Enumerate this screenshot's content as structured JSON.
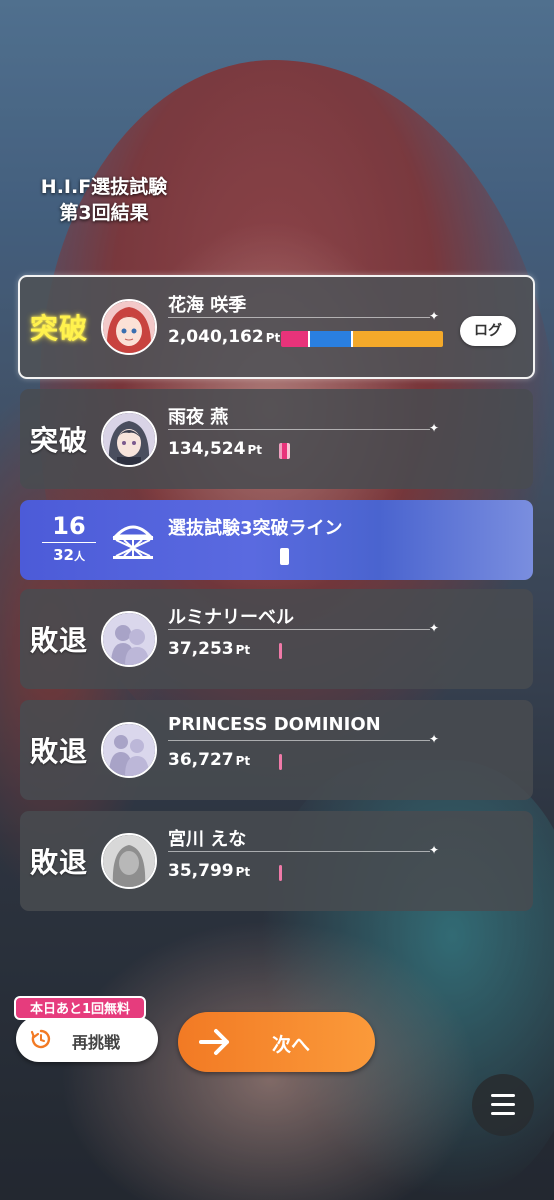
{
  "result_title": {
    "line1": "H.I.F選抜試験",
    "line2": "第3回結果"
  },
  "entries": [
    {
      "status": "突破",
      "name": "花海 咲季",
      "points": "2,040,162",
      "unit": "Pt",
      "log_label": "ログ",
      "highlight": true
    },
    {
      "status": "突破",
      "name": "雨夜 燕",
      "points": "134,524",
      "unit": "Pt"
    },
    {
      "status": "敗退",
      "name": "ルミナリーベル",
      "points": "37,253",
      "unit": "Pt"
    },
    {
      "status": "敗退",
      "name": "PRINCESS DOMINION",
      "points": "36,727",
      "unit": "Pt"
    },
    {
      "status": "敗退",
      "name": "宮川 えな",
      "points": "35,799",
      "unit": "Pt"
    }
  ],
  "cutline": {
    "rank": "16",
    "total": "32",
    "total_unit": "人",
    "label": "選抜試験3突破ライン"
  },
  "bottom": {
    "free_badge": "本日あと1回無料",
    "retry_label": "再挑戦",
    "next_label": "次へ"
  },
  "colors": {
    "pink": "#e8337a",
    "blue": "#2a7fe0",
    "orange": "#f4a92a",
    "next_button": "#f58a2e"
  },
  "icons": [
    "sparkle-icon",
    "gate-icon",
    "retry-clock-icon",
    "arrow-right-icon",
    "hamburger-menu-icon"
  ]
}
